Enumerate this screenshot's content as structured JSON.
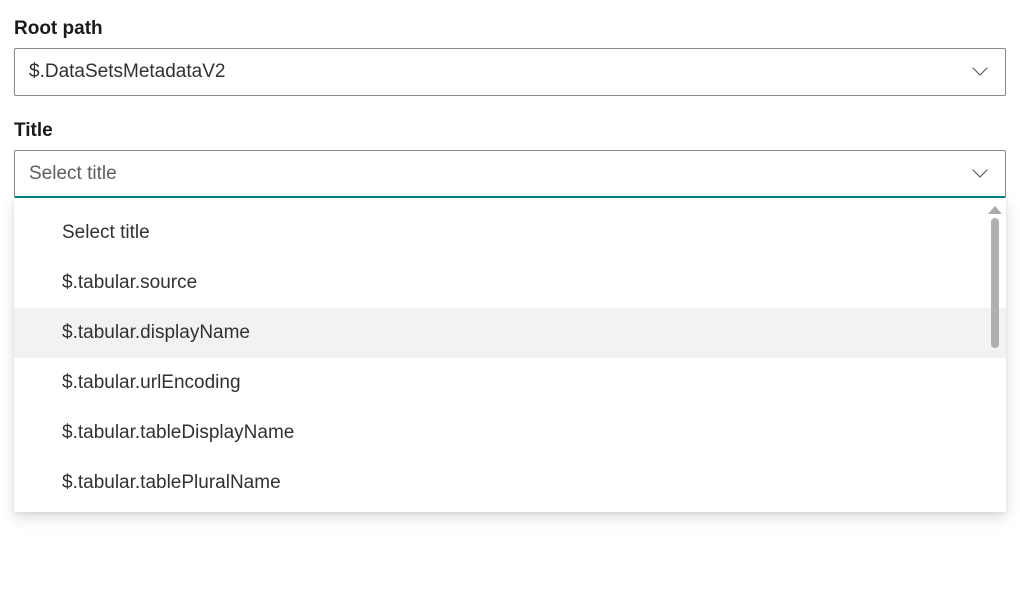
{
  "rootPath": {
    "label": "Root path",
    "value": "$.DataSetsMetadataV2"
  },
  "title": {
    "label": "Title",
    "placeholder": "Select title",
    "options": [
      "Select title",
      "$.tabular.source",
      "$.tabular.displayName",
      "$.tabular.urlEncoding",
      "$.tabular.tableDisplayName",
      "$.tabular.tablePluralName"
    ],
    "hoveredIndex": 2
  }
}
